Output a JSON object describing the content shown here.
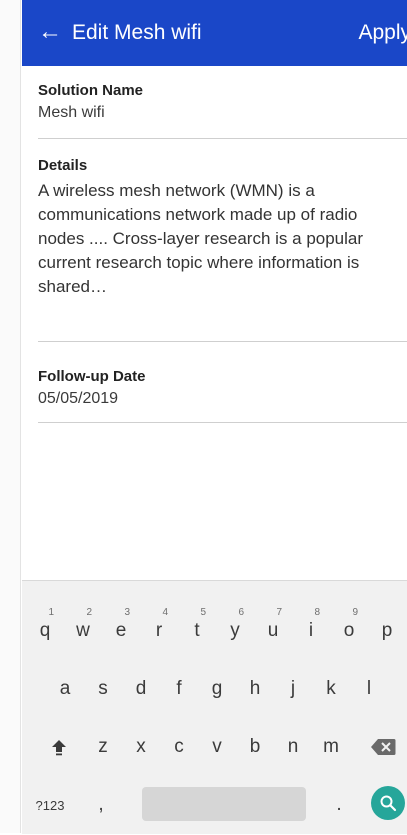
{
  "appbar": {
    "back_icon": "arrow-left-icon",
    "title": "Edit Mesh wifi",
    "apply_label": "Apply"
  },
  "form": {
    "solution_name": {
      "label": "Solution Name",
      "value": "Mesh wifi"
    },
    "details": {
      "label": "Details",
      "value": "A wireless mesh network (WMN) is a communications network made up of radio nodes .... Cross-layer research is a popular current research topic where information is shared…"
    },
    "followup_date": {
      "label": "Follow-up Date",
      "value": "05/05/2019"
    }
  },
  "keyboard": {
    "row1": [
      {
        "key": "q",
        "hint": "1"
      },
      {
        "key": "w",
        "hint": "2"
      },
      {
        "key": "e",
        "hint": "3"
      },
      {
        "key": "r",
        "hint": "4"
      },
      {
        "key": "t",
        "hint": "5"
      },
      {
        "key": "y",
        "hint": "6"
      },
      {
        "key": "u",
        "hint": "7"
      },
      {
        "key": "i",
        "hint": "8"
      },
      {
        "key": "o",
        "hint": "9"
      },
      {
        "key": "p",
        "hint": ""
      }
    ],
    "row2": [
      "a",
      "s",
      "d",
      "f",
      "g",
      "h",
      "j",
      "k",
      "l"
    ],
    "row3": [
      "z",
      "x",
      "c",
      "v",
      "b",
      "n",
      "m"
    ],
    "shift_icon": "shift-icon",
    "backspace_icon": "backspace-icon",
    "symbols_label": "?123",
    "comma_label": ",",
    "period_label": ".",
    "search_icon": "search-icon",
    "search_color": "#26a69a"
  },
  "colors": {
    "appbar": "#1a47c8"
  }
}
